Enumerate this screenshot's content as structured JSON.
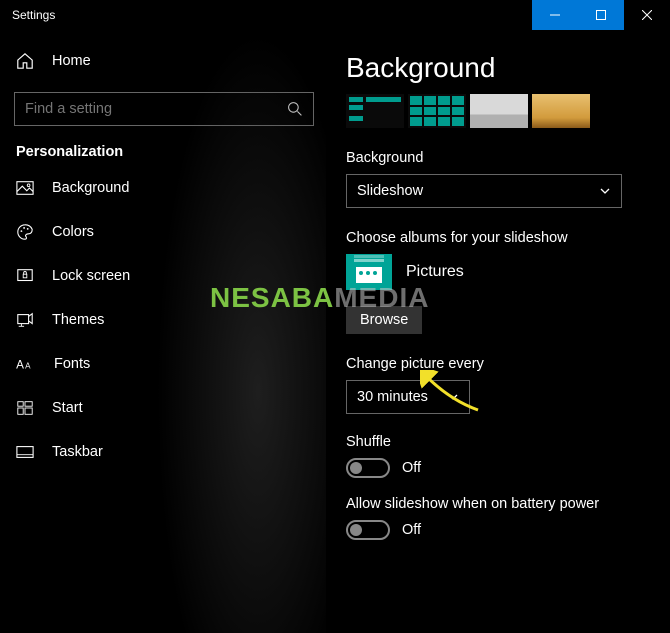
{
  "titlebar": {
    "title": "Settings"
  },
  "sidebar": {
    "home": "Home",
    "search_placeholder": "Find a setting",
    "category": "Personalization",
    "items": [
      {
        "label": "Background"
      },
      {
        "label": "Colors"
      },
      {
        "label": "Lock screen"
      },
      {
        "label": "Themes"
      },
      {
        "label": "Fonts"
      },
      {
        "label": "Start"
      },
      {
        "label": "Taskbar"
      }
    ]
  },
  "main": {
    "page_title": "Background",
    "bg_label": "Background",
    "bg_value": "Slideshow",
    "albums_label": "Choose albums for your slideshow",
    "album_name": "Pictures",
    "browse_label": "Browse",
    "change_label": "Change picture every",
    "change_value": "30 minutes",
    "shuffle_label": "Shuffle",
    "shuffle_state": "Off",
    "battery_label": "Allow slideshow when on battery power",
    "battery_state": "Off"
  },
  "watermark": "NESABAMEDIA"
}
